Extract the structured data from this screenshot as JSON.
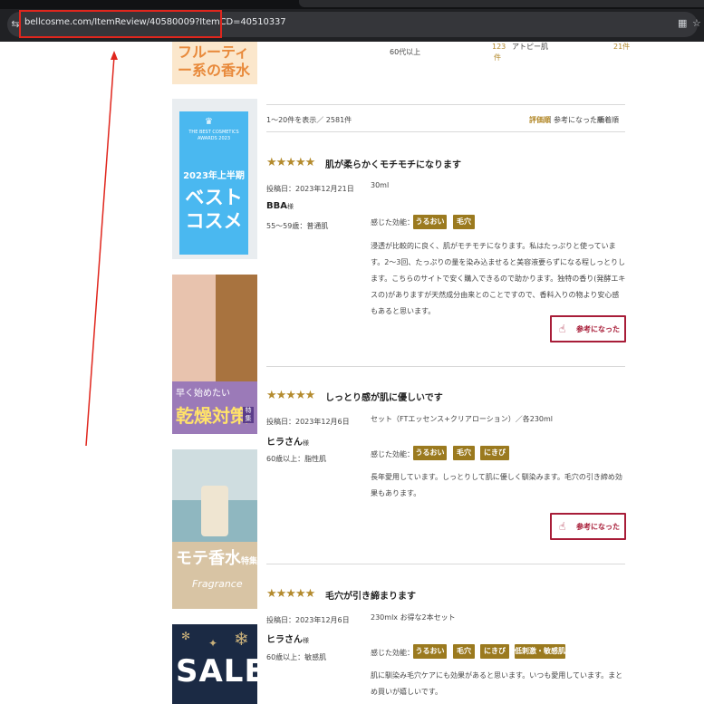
{
  "browser": {
    "url": "bellcosme.com/ItemReview/40580009?ItemCD=40510337",
    "site_icon": "tune-icon",
    "extensions_icon": "grid-icon",
    "bookmark_icon": "star-icon"
  },
  "ads": {
    "fruity": "フルーティー系の香水",
    "best_award": "THE BEST COSMETICS AWARDS 2023",
    "best_period": "2023年上半期",
    "best_title": "ベストコスメ",
    "dry_sub": "早く始めたい",
    "dry_title": "乾燥対策",
    "dry_tag": "特集",
    "mote_title": "モテ香水",
    "mote_tag": "特集",
    "mote_script": "Fragrance",
    "sale": "SALE"
  },
  "prev_row": {
    "age": "60代以上",
    "count": "123件",
    "skin": "アトピー肌",
    "right": "21件"
  },
  "list": {
    "count_text": "1～20件を表示／ 2581件",
    "sort_rating": "評価順",
    "sort_helpful": "参考になった順",
    "sort_new": "新着順",
    "sep": "|"
  },
  "labels": {
    "effect_label": "感じた効能：",
    "helpful_button": "参考になった",
    "sama": "様",
    "stars": "★★★★★"
  },
  "reviews": [
    {
      "title": "肌が柔らかくモチモチになります",
      "date": "投稿日：2023年12月21日",
      "user": "BBA",
      "meta": "55～59歳：普通肌",
      "product": "30ml",
      "tags": [
        "うるおい",
        "毛穴"
      ],
      "body": "浸透が比較的に良く、肌がモチモチになります。私はたっぷりと使っています。2～3回、たっぷりの量を染み込ませると美容液要らずになる程しっとりします。こちらのサイトで安く購入できるので助かります。独特の香り(発酵エキスの)がありますが天然成分由来とのことですので、香料入りの物より安心感もあると思います。"
    },
    {
      "title": "しっとり感が肌に優しいです",
      "date": "投稿日：2023年12月6日",
      "user": "ヒラさん",
      "meta": "60歳以上：脂性肌",
      "product": "セット（FTエッセンス+クリアローション）／各230ml",
      "tags": [
        "うるおい",
        "毛穴",
        "にきび"
      ],
      "body": "長年愛用しています。しっとりして肌に優しく馴染みます。毛穴の引き締め効果もあります。"
    },
    {
      "title": "毛穴が引き締まります",
      "date": "投稿日：2023年12月6日",
      "user": "ヒラさん",
      "meta": "60歳以上：敏感肌",
      "product": "230mlx お得な2本セット",
      "tags": [
        "うるおい",
        "毛穴",
        "にきび",
        "低刺激・敏感肌"
      ],
      "body": "肌に馴染み毛穴ケアにも効果があると思います。いつも愛用しています。まとめ買いが嬉しいです。"
    }
  ],
  "colors": {
    "gold": "#b48b2e",
    "tag": "#9b7a1f",
    "helpful": "#a81d38",
    "annotation": "#e0261d"
  }
}
